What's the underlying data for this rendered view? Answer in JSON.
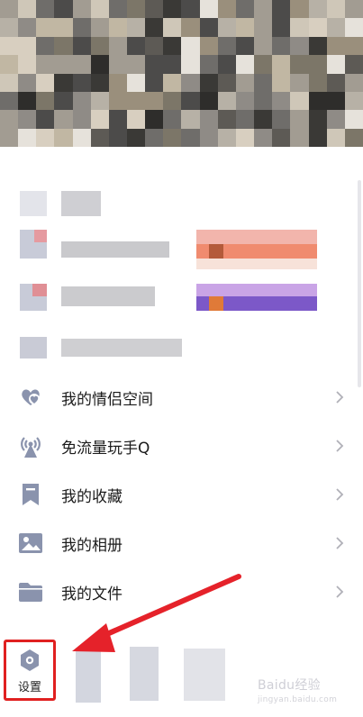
{
  "menu": {
    "items": [
      {
        "label": "我的情侣空间",
        "icon": "couple-heart-icon"
      },
      {
        "label": "免流量玩手Q",
        "icon": "antenna-icon"
      },
      {
        "label": "我的收藏",
        "icon": "bookmark-icon"
      },
      {
        "label": "我的相册",
        "icon": "photo-album-icon"
      },
      {
        "label": "我的文件",
        "icon": "folder-icon"
      }
    ]
  },
  "bottom_bar": {
    "settings_label": "设置"
  },
  "watermark": {
    "main": "Baidu经验",
    "sub": "jingyan.baidu.com"
  },
  "colors": {
    "icon": "#8a93ad",
    "highlight_box": "#e02020",
    "arrow": "#e5222a"
  }
}
